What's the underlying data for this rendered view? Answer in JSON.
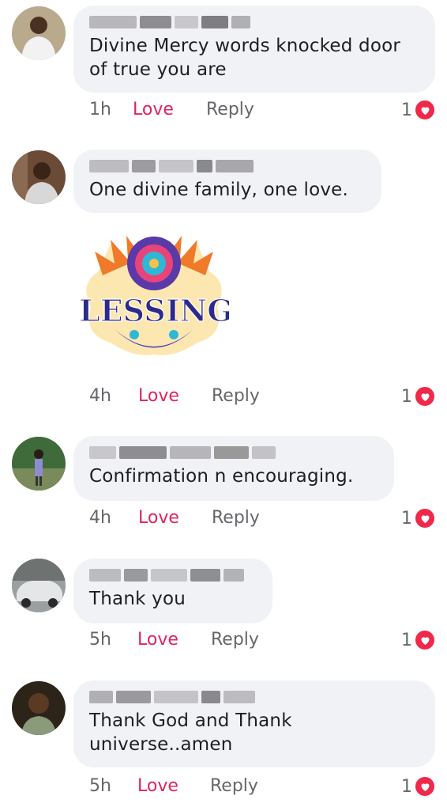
{
  "comments": [
    {
      "text": "Divine Mercy words knocked door of true you are",
      "time": "1h",
      "love": "Love",
      "reply": "Reply",
      "reactions": "1"
    },
    {
      "text": "One divine family, one love.",
      "time": "4h",
      "love": "Love",
      "reply": "Reply",
      "reactions": "1"
    },
    {
      "text": "Confirmation n encouraging.",
      "time": "4h",
      "love": "Love",
      "reply": "Reply",
      "reactions": "1"
    },
    {
      "text": "Thank you",
      "time": "5h",
      "love": "Love",
      "reply": "Reply",
      "reactions": "1"
    },
    {
      "text": "Thank God and Thank universe..amen",
      "time": "5h",
      "love": "Love",
      "reply": "Reply",
      "reactions": "1"
    }
  ],
  "sticker": {
    "text": "BLESSINGS"
  },
  "colors": {
    "love": "#e0245e",
    "heart": "#f0284a",
    "bubble": "#f0f2f5",
    "meta": "#65676b"
  }
}
